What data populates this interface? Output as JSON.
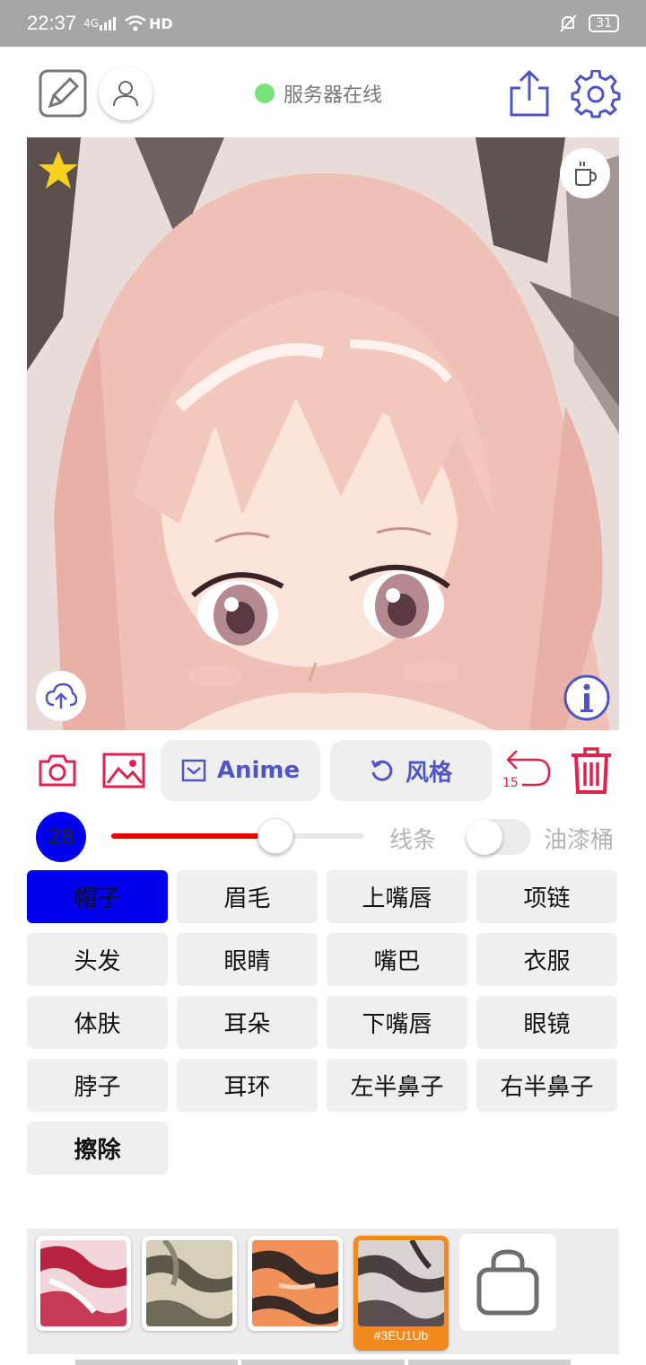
{
  "statusbar": {
    "time": "22:37",
    "network": "4G",
    "hd": "HD",
    "battery": "31"
  },
  "header": {
    "server_status": "服务器在线"
  },
  "toolbar": {
    "anime_label": "Anime",
    "style_label": "风格",
    "undo_count": "15"
  },
  "brush": {
    "size": "28",
    "lines_label": "线条",
    "bucket_label": "油漆桶",
    "slider_level": 0.65
  },
  "parts": [
    {
      "label": "帽子",
      "active": true
    },
    {
      "label": "眉毛"
    },
    {
      "label": "上嘴唇"
    },
    {
      "label": "项链"
    },
    {
      "label": "头发"
    },
    {
      "label": "眼睛"
    },
    {
      "label": "嘴巴"
    },
    {
      "label": "衣服"
    },
    {
      "label": "体肤"
    },
    {
      "label": "耳朵"
    },
    {
      "label": "下嘴唇"
    },
    {
      "label": "眼镜"
    },
    {
      "label": "脖子"
    },
    {
      "label": "耳环"
    },
    {
      "label": "左半鼻子"
    },
    {
      "label": "右半鼻子"
    },
    {
      "label": "擦除",
      "bold": true
    }
  ],
  "styles": {
    "selected_code": "#3EU1Ub"
  },
  "colors": {
    "accent": "#5055c6",
    "red": "#e0234e",
    "active_part": "#0000ee",
    "online": "#7be37b"
  }
}
